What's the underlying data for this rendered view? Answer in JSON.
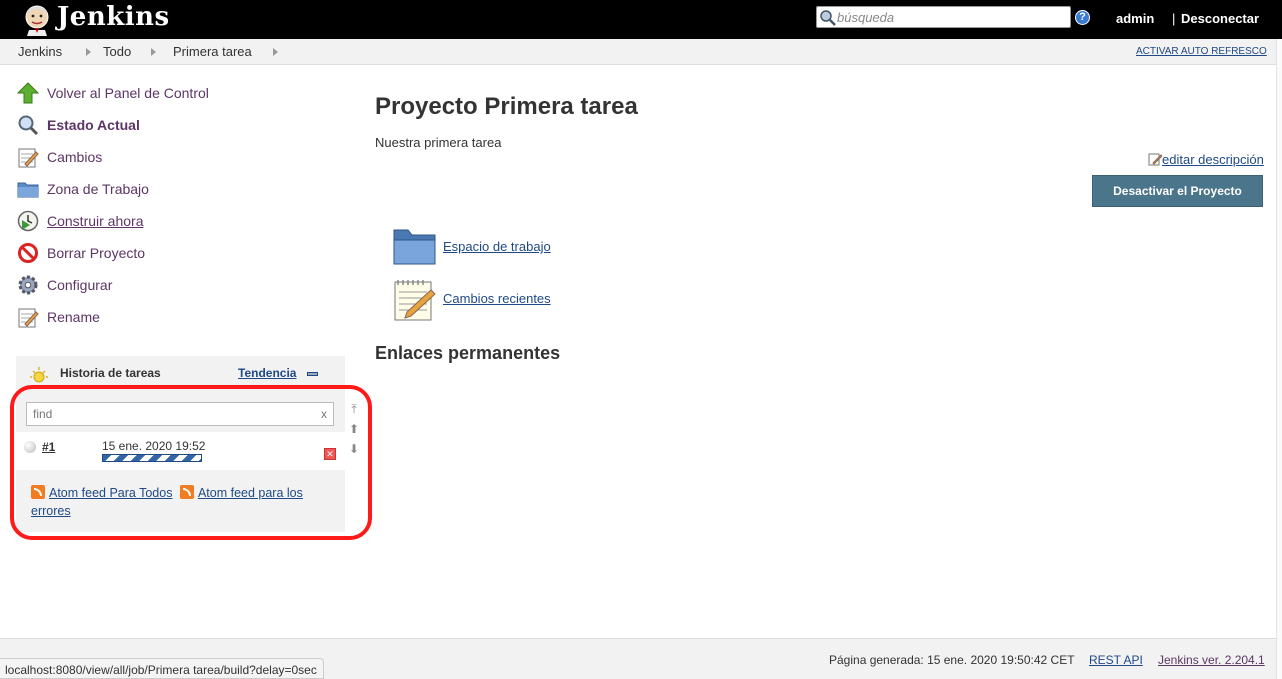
{
  "header": {
    "brand": "Jenkins",
    "search_placeholder": "búsqueda",
    "help_glyph": "?",
    "user": "admin",
    "logout_sep": "|",
    "logout": "Desconectar"
  },
  "breadcrumb": {
    "items": [
      "Jenkins",
      "Todo",
      "Primera tarea"
    ],
    "autorefresh": "ACTIVAR AUTO REFRESCO"
  },
  "sidebar": {
    "tasks": [
      {
        "label": "Volver al Panel de Control",
        "icon": "up-arrow-icon"
      },
      {
        "label": "Estado Actual",
        "icon": "magnifier-icon"
      },
      {
        "label": "Cambios",
        "icon": "notepad-icon"
      },
      {
        "label": "Zona de Trabajo",
        "icon": "folder-icon"
      },
      {
        "label": "Construir ahora",
        "icon": "clock-play-icon"
      },
      {
        "label": "Borrar Proyecto",
        "icon": "no-entry-icon"
      },
      {
        "label": "Configurar",
        "icon": "gear-icon"
      },
      {
        "label": "Rename",
        "icon": "notepad-icon"
      }
    ]
  },
  "history": {
    "title": "Historia de tareas",
    "trend": "Tendencia",
    "find_placeholder": "find",
    "find_clear": "x",
    "build": {
      "number": "#1",
      "date": "15 ene. 2020 19:52"
    },
    "feed_all": "Atom feed Para Todos",
    "feed_errors": "Atom feed para los errores"
  },
  "main": {
    "title": "Proyecto Primera tarea",
    "description": "Nuestra primera tarea",
    "edit_description": "editar descripción",
    "disable_button": "Desactivar el Proyecto",
    "links": [
      {
        "label": "Espacio de trabajo",
        "icon": "folder-icon"
      },
      {
        "label": "Cambios recientes",
        "icon": "notepad-icon"
      }
    ],
    "permalinks_heading": "Enlaces permanentes"
  },
  "footer": {
    "generated": "Página generada: 15 ene. 2020 19:50:42 CET",
    "rest_api": "REST API",
    "version": "Jenkins ver. 2.204.1"
  },
  "status_url": "localhost:8080/view/all/job/Primera tarea/build?delay=0sec",
  "colors": {
    "header_bg": "#000000",
    "button_bg": "#4b758b",
    "link": "#204a87",
    "visited": "#5c3566",
    "highlight": "#ff1a1a"
  }
}
